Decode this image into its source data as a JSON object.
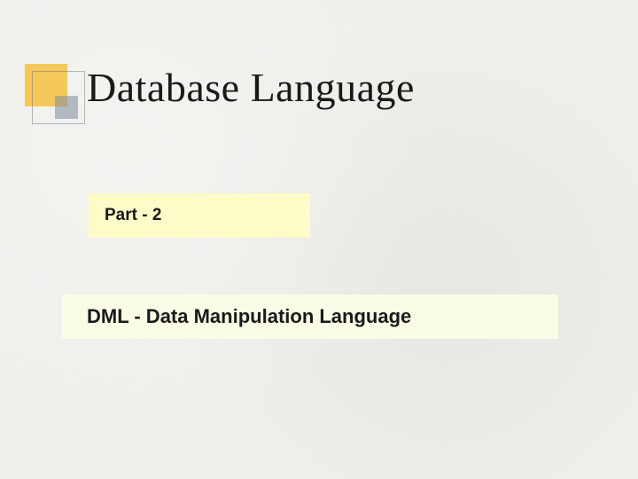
{
  "slide": {
    "title": "Database Language",
    "part_label": "Part - 2",
    "subtitle": "DML - Data Manipulation Language"
  }
}
